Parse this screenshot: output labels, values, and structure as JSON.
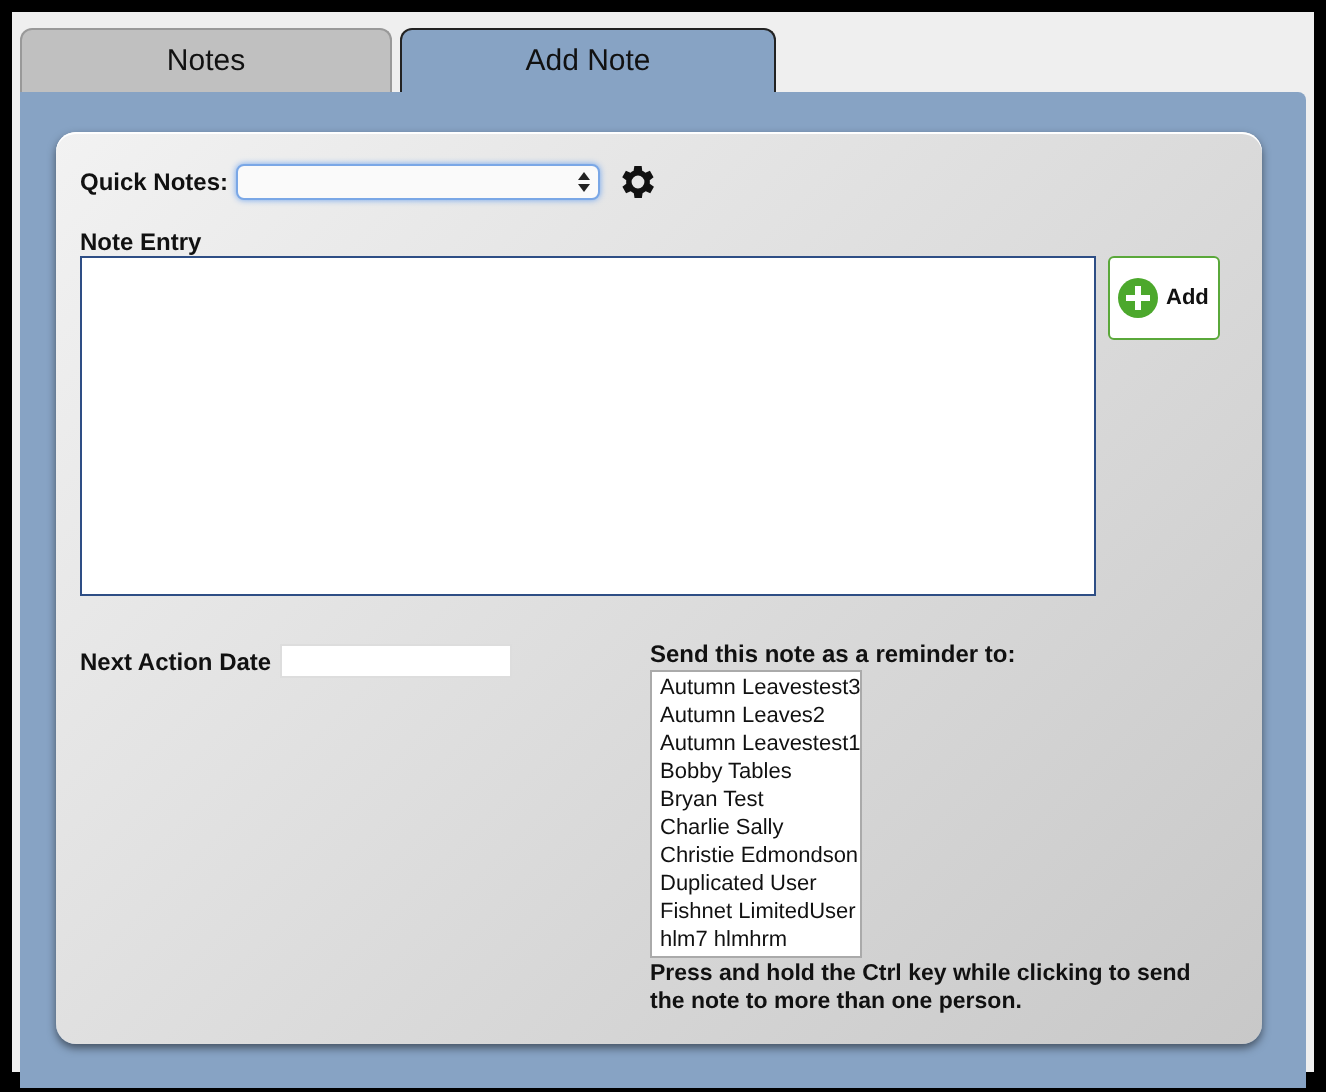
{
  "tabs": [
    {
      "label": "Notes",
      "selected": false
    },
    {
      "label": "Add Note",
      "selected": true
    }
  ],
  "quick_notes": {
    "label": "Quick Notes:"
  },
  "note_entry": {
    "label": "Note Entry"
  },
  "add_button": {
    "label": "Add"
  },
  "next_action_date": {
    "label": "Next Action Date"
  },
  "reminder": {
    "label": "Send this note as a reminder to:",
    "recipients": [
      {
        "name": "Autumn Leavestest3",
        "selected": false
      },
      {
        "name": "Autumn Leaves2",
        "selected": false
      },
      {
        "name": "Autumn Leavestest1",
        "selected": false
      },
      {
        "name": "Bobby Tables",
        "selected": false
      },
      {
        "name": "Bryan Test",
        "selected": false
      },
      {
        "name": "Charlie Sally",
        "selected": false
      },
      {
        "name": "Christie Edmondson",
        "selected": false
      },
      {
        "name": "Duplicated User",
        "selected": false
      },
      {
        "name": "Fishnet LimitedUser",
        "selected": false
      },
      {
        "name": "hlm7 hlmhrm",
        "selected": false
      }
    ],
    "hint": "Press and hold the Ctrl key while clicking to send the note to more than one person."
  }
}
